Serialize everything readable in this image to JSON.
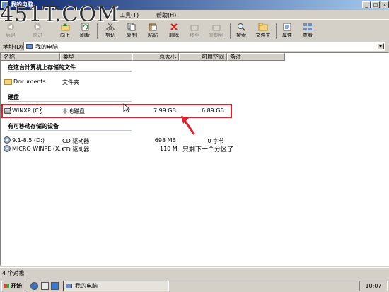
{
  "window": {
    "title": "我的电脑"
  },
  "watermark": "451T.COM",
  "menubar": {
    "tools": "工具(T)",
    "help": "帮助(H)"
  },
  "toolbar": {
    "back": "后退",
    "forward": "前进",
    "up": "向上",
    "refresh": "刷新",
    "cut": "剪切",
    "copy": "复制",
    "paste": "粘贴",
    "delete": "删除",
    "move_to": "移至",
    "copy_to": "复制到",
    "search": "搜索",
    "folders": "文件夹",
    "properties": "属性",
    "views": "查看"
  },
  "address": {
    "label": "地址(D)",
    "value": "我的电脑"
  },
  "columns": {
    "name": "名称",
    "type": "类型",
    "total": "总大小",
    "free": "可用空间",
    "comments": "备注"
  },
  "groups": {
    "stored": {
      "title": "在这台计算机上存储的文件",
      "items": [
        {
          "name": "Documents",
          "type": "文件夹"
        }
      ]
    },
    "hdd": {
      "title": "硬盘",
      "items": [
        {
          "name": "WINXP (C:)",
          "type": "本地磁盘",
          "total": "7.99 GB",
          "free": "6.89 GB"
        }
      ]
    },
    "removable": {
      "title": "有可移动存储的设备",
      "items": [
        {
          "name": "9.1-8.5 (D:)",
          "type": "CD 驱动器",
          "total": "698 MB",
          "free": "0 字节"
        },
        {
          "name": "MICRO WINPE (X:)",
          "type": "CD 驱动器",
          "total": "110 M"
        }
      ]
    }
  },
  "annotation": "只剩下一个分区了",
  "status": {
    "text": "4 个对象"
  },
  "taskbar": {
    "start": "开始",
    "task": "我的电脑",
    "clock": "10:07"
  },
  "colors": {
    "highlight": "#e0202a",
    "titlebar": "#0a246a"
  }
}
